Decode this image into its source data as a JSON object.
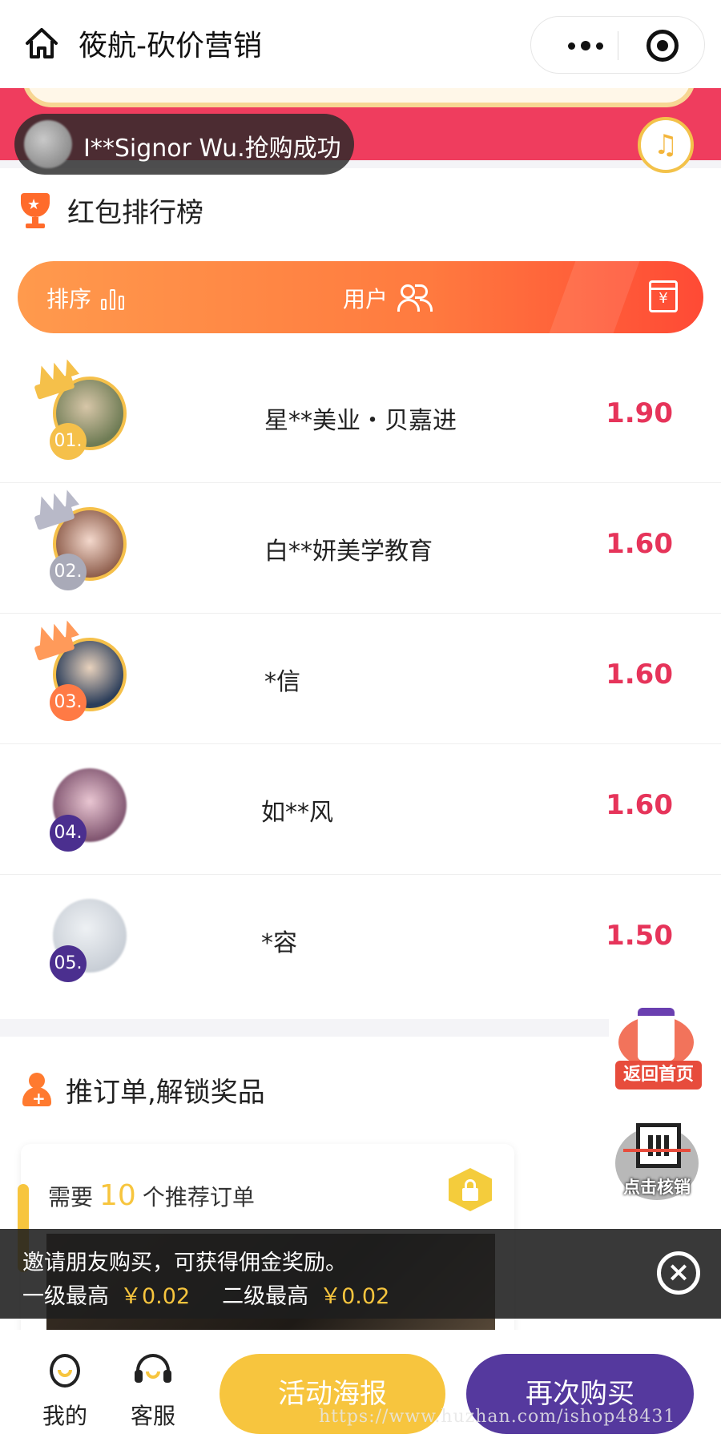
{
  "header": {
    "title": "筱航-砍价营销",
    "icons": [
      "home-icon",
      "more-icon",
      "close-miniprogram-icon"
    ]
  },
  "toast": {
    "text": "I**Signor Wu.抢购成功"
  },
  "ranking": {
    "section_title": "红包排行榜",
    "columns": {
      "rank_label": "排序",
      "user_label": "用户"
    },
    "rows": [
      {
        "rank": "01.",
        "name": "星**美业・贝嘉进",
        "amount": "1.90",
        "badge_color": "#f5c04a",
        "crown": "gold"
      },
      {
        "rank": "02.",
        "name": "白**妍美学教育",
        "amount": "1.60",
        "badge_color": "#a9aab8",
        "crown": "silver"
      },
      {
        "rank": "03.",
        "name": "*信",
        "amount": "1.60",
        "badge_color": "#ff7a45",
        "crown": "bronze"
      },
      {
        "rank": "04.",
        "name": "如**风",
        "amount": "1.60",
        "badge_color": "#4b2f8f",
        "crown": "none"
      },
      {
        "rank": "05.",
        "name": "*容",
        "amount": "1.50",
        "badge_color": "#4b2f8f",
        "crown": "none"
      }
    ]
  },
  "floating": {
    "home_label": "返回首页",
    "verify_label": "点击核销"
  },
  "recommend": {
    "section_title": "推订单,解锁奖品",
    "need_prefix": "需要",
    "need_count": "10",
    "need_suffix": "个推荐订单"
  },
  "invite": {
    "line1": "邀请朋友购买，可获得佣金奖励。",
    "level1_label": "一级最高",
    "level1_value": "￥0.02",
    "level2_label": "二级最高",
    "level2_value": "￥0.02"
  },
  "tabbar": {
    "me_label": "我的",
    "service_label": "客服",
    "poster_button": "活动海报",
    "rebuy_button": "再次购买",
    "watermark": "https://www.huzhan.com/ishop48431"
  },
  "colors": {
    "accent_red": "#e6345a",
    "banner_red": "#ef3d5e",
    "gold": "#f7c53e",
    "purple": "#55399e",
    "orange_gradient_start": "#ff9a4d",
    "orange_gradient_end": "#ff4a35"
  }
}
